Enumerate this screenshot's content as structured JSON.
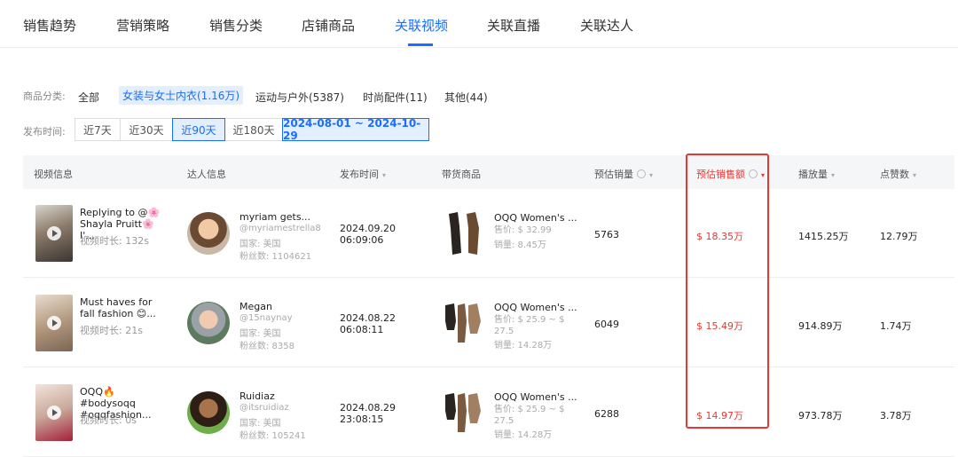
{
  "tabs": [
    {
      "label": "销售趋势"
    },
    {
      "label": "营销策略"
    },
    {
      "label": "销售分类"
    },
    {
      "label": "店铺商品"
    },
    {
      "label": "关联视频",
      "active": true
    },
    {
      "label": "关联直播"
    },
    {
      "label": "关联达人"
    }
  ],
  "filters": {
    "category_label": "商品分类:",
    "categories": [
      "全部",
      "女装与女士内衣(1.16万)",
      "运动与户外(5387)",
      "时尚配件(11)",
      "其他(44)"
    ],
    "selected_category": "女装与女士内衣(1.16万)",
    "time_label": "发布时间:",
    "time_options": [
      "近7天",
      "近30天",
      "近90天",
      "近180天"
    ],
    "selected_time": "近90天",
    "date_range": "2024-08-01 ~ 2024-10-29"
  },
  "table": {
    "headers": {
      "video": "视频信息",
      "creator": "达人信息",
      "publish_time": "发布时间",
      "product": "带货商品",
      "est_sales": "预估销量",
      "est_revenue": "预估销售额",
      "plays": "播放量",
      "likes": "点赞数"
    },
    "rows": [
      {
        "video_title": "Replying to @🌸 Shayla Pruitt🌸 I'...",
        "video_duration": "视频时长: 132s",
        "creator_name": "myriam gets...",
        "creator_handle": "@myriamestrella8",
        "creator_country": "国家: 美国",
        "creator_fans": "粉丝数: 1104621",
        "date": "2024.09.20",
        "time": "06:09:06",
        "product_name": "OQQ Women's ...",
        "product_price": "售价: $ 32.99",
        "product_sales": "销量: 8.45万",
        "est_sales": "5763",
        "est_revenue": "$ 18.35万",
        "plays": "1415.25万",
        "likes": "12.79万"
      },
      {
        "video_title": "Must haves for fall fashion 😊...",
        "video_duration": "视频时长: 21s",
        "creator_name": "Megan",
        "creator_handle": "@15naynay",
        "creator_country": "国家: 美国",
        "creator_fans": "粉丝数: 8358",
        "date": "2024.08.22",
        "time": "06:08:11",
        "product_name": "OQQ Women's ...",
        "product_price": "售价: $ 25.9 ~ $ 27.5",
        "product_sales": "销量: 14.28万",
        "est_sales": "6049",
        "est_revenue": "$ 15.49万",
        "plays": "914.89万",
        "likes": "1.74万"
      },
      {
        "video_title": "OQQ🔥#bodysoqq #oqqfashion...",
        "video_duration": "视频时长: 0s",
        "creator_name": "Ruidiaz",
        "creator_handle": "@itsruidiaz",
        "creator_country": "国家: 美国",
        "creator_fans": "粉丝数: 105241",
        "date": "2024.08.29",
        "time": "23:08:15",
        "product_name": "OQQ Women's ...",
        "product_price": "售价: $ 25.9 ~ $ 27.5",
        "product_sales": "销量: 14.28万",
        "est_sales": "6288",
        "est_revenue": "$ 14.97万",
        "plays": "973.78万",
        "likes": "3.78万"
      }
    ]
  },
  "colors": {
    "accent": "#1a6dff",
    "highlight": "#e53935",
    "header_bg": "#f5f6f8"
  }
}
